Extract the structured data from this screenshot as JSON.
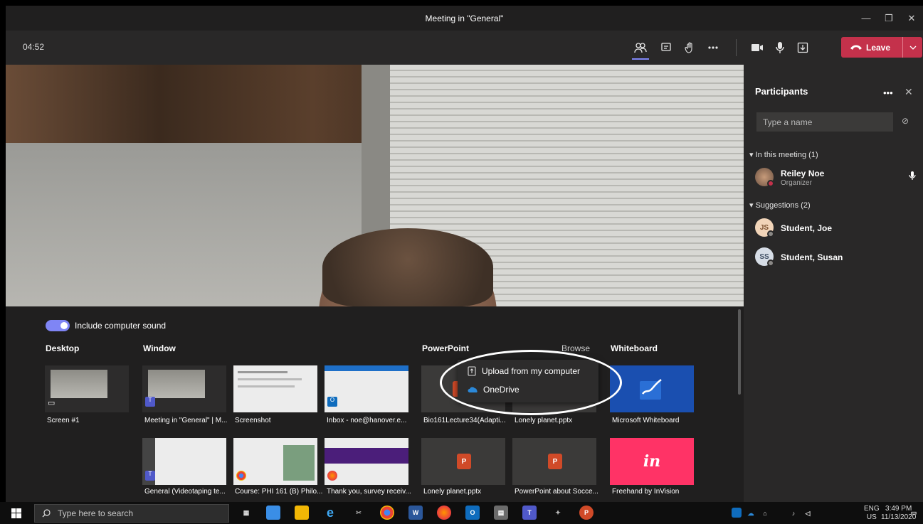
{
  "window": {
    "title": "Meeting in \"General\"",
    "controls": [
      "—",
      "❐",
      "✕"
    ]
  },
  "toolbar": {
    "timer": "04:52",
    "leave_label": "Leave"
  },
  "participants": {
    "title": "Participants",
    "search_placeholder": "Type a name",
    "in_meeting_header": "In this meeting (1)",
    "suggestions_header": "Suggestions (2)",
    "members": [
      {
        "name": "Reiley Noe",
        "role": "Organizer"
      }
    ],
    "suggestions": [
      {
        "initials": "JS",
        "name": "Student, Joe"
      },
      {
        "initials": "SS",
        "name": "Student, Susan"
      }
    ]
  },
  "share": {
    "include_sound_label": "Include computer sound",
    "include_sound_on": true,
    "headers": {
      "desktop": "Desktop",
      "window": "Window",
      "powerpoint": "PowerPoint",
      "whiteboard": "Whiteboard"
    },
    "browse_label": "Browse",
    "desktop": [
      {
        "caption": "Screen #1"
      }
    ],
    "windows": [
      {
        "caption": "Meeting in \"General\" | M..."
      },
      {
        "caption": "Screenshot"
      },
      {
        "caption": "Inbox - noe@hanover.e..."
      },
      {
        "caption": "General (Videotaping te..."
      },
      {
        "caption": "Course: PHI 161 (B) Philo..."
      },
      {
        "caption": "Thank you, survey receiv..."
      }
    ],
    "powerpoint": [
      {
        "caption": "Bio161Lecture34(Adapti..."
      },
      {
        "caption": "Lonely planet.pptx"
      },
      {
        "caption": "Lonely planet.pptx"
      },
      {
        "caption": "PowerPoint about Socce..."
      }
    ],
    "whiteboard": [
      {
        "caption": "Microsoft Whiteboard"
      },
      {
        "caption": "Freehand by InVision"
      }
    ],
    "freehand_glyph": "in",
    "upload_menu": {
      "upload": "Upload from my computer",
      "onedrive": "OneDrive"
    }
  },
  "taskbar": {
    "search_placeholder": "Type here to search",
    "lang": "ENG",
    "region": "US",
    "time": "3:49 PM",
    "date": "11/13/2020"
  },
  "colors": {
    "leave": "#c4314b",
    "accent": "#7f85f5",
    "whiteboard": "#1a4fb0",
    "freehand": "#ff3366"
  }
}
